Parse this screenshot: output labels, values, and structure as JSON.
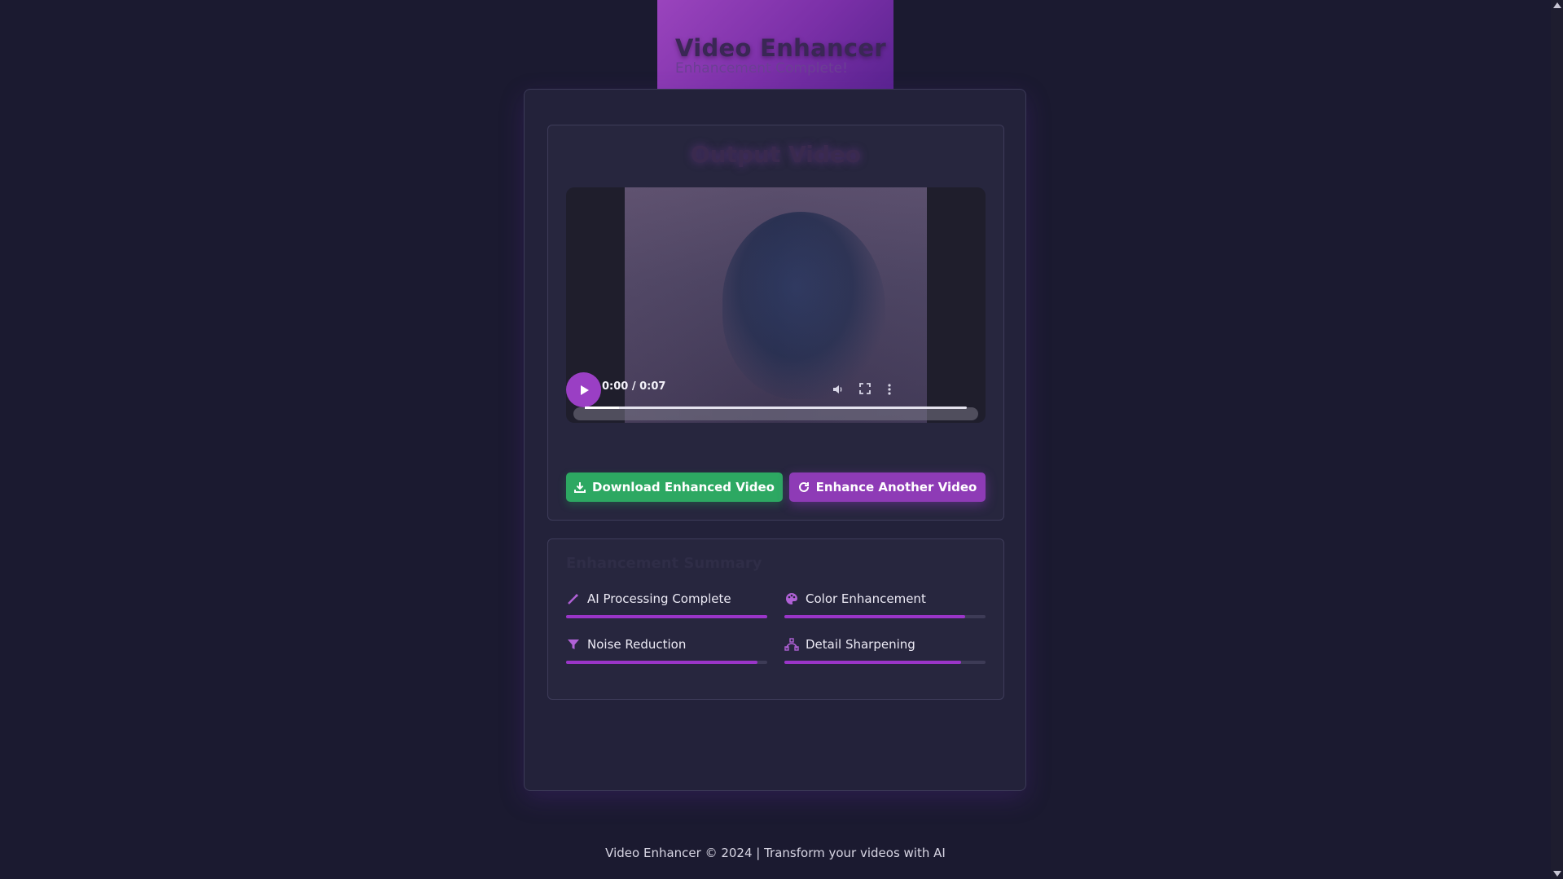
{
  "header": {
    "title": "Video Enhancer",
    "subtitle": "Enhancement Complete!"
  },
  "output": {
    "title": "Output Video",
    "player": {
      "time": "0:00 / 0:07",
      "progress": 0.09
    }
  },
  "buttons": {
    "download": "Download Enhanced Video",
    "enhance_another": "Enhance Another Video"
  },
  "summary": {
    "title": "Enhancement Summary",
    "items": [
      {
        "label": "AI Processing Complete",
        "icon": "magic-wand-icon",
        "value": 1.0
      },
      {
        "label": "Color Enhancement",
        "icon": "palette-icon",
        "value": 0.9
      },
      {
        "label": "Noise Reduction",
        "icon": "filter-icon",
        "value": 0.95
      },
      {
        "label": "Detail Sharpening",
        "icon": "bezier-curve-icon",
        "value": 0.88
      }
    ]
  },
  "footer": "Video Enhancer © 2024 | Transform your videos with AI",
  "colors": {
    "accent": "#9a35c8",
    "success": "#2da862",
    "background": "#1b1a30"
  }
}
